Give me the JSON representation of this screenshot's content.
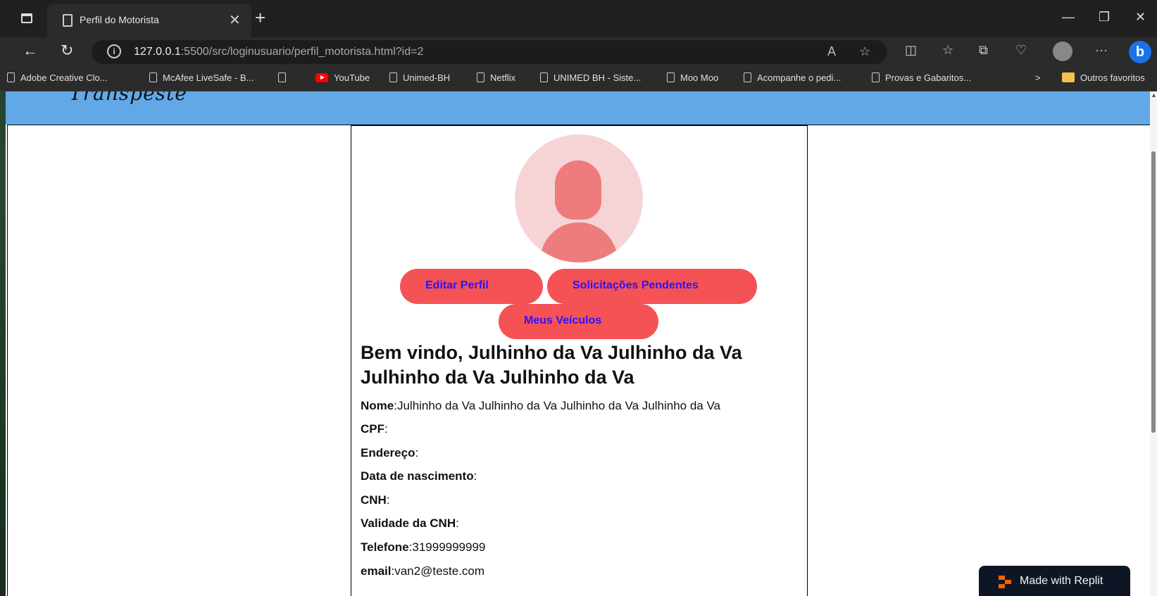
{
  "browser": {
    "tab_title": "Perfil do Motorista",
    "url_host": "127.0.0.1",
    "url_rest": ":5500/src/loginusuario/perfil_motorista.html?id=2",
    "bookmarks": [
      "Adobe Creative Clo...",
      "McAfee LiveSafe - B...",
      "",
      "YouTube",
      "Unimed-BH",
      "Netflix",
      "UNIMED BH - Siste...",
      "Moo Moo",
      "Acompanhe o pedi...",
      "Provas e Gabaritos..."
    ],
    "other_favorites": "Outros favoritos"
  },
  "profile": {
    "buttons": {
      "edit": "Editar Perfil",
      "requests": "Solicitações Pendentes",
      "vehicles": "Meus Veículos"
    },
    "welcome": "Bem vindo, Julhinho da Va Julhinho da Va Julhinho da Va Julhinho da Va",
    "fields": [
      {
        "label": "Nome",
        "value": "Julhinho da Va Julhinho da Va Julhinho da Va Julhinho da Va"
      },
      {
        "label": "CPF",
        "value": ""
      },
      {
        "label": "Endereço",
        "value": ""
      },
      {
        "label": "Data de nascimento",
        "value": ""
      },
      {
        "label": "CNH",
        "value": ""
      },
      {
        "label": "Validade da CNH",
        "value": ""
      },
      {
        "label": "Telefone",
        "value": "31999999999"
      },
      {
        "label": "email",
        "value": "van2@teste.com"
      }
    ]
  },
  "replit_badge": "Made with Replit",
  "colors": {
    "header_blue": "#63a8e6",
    "button_red": "#f45255",
    "button_text": "#2a14ff",
    "avatar_bg": "#f6d4d6",
    "avatar_fg": "#ee7c7c"
  }
}
